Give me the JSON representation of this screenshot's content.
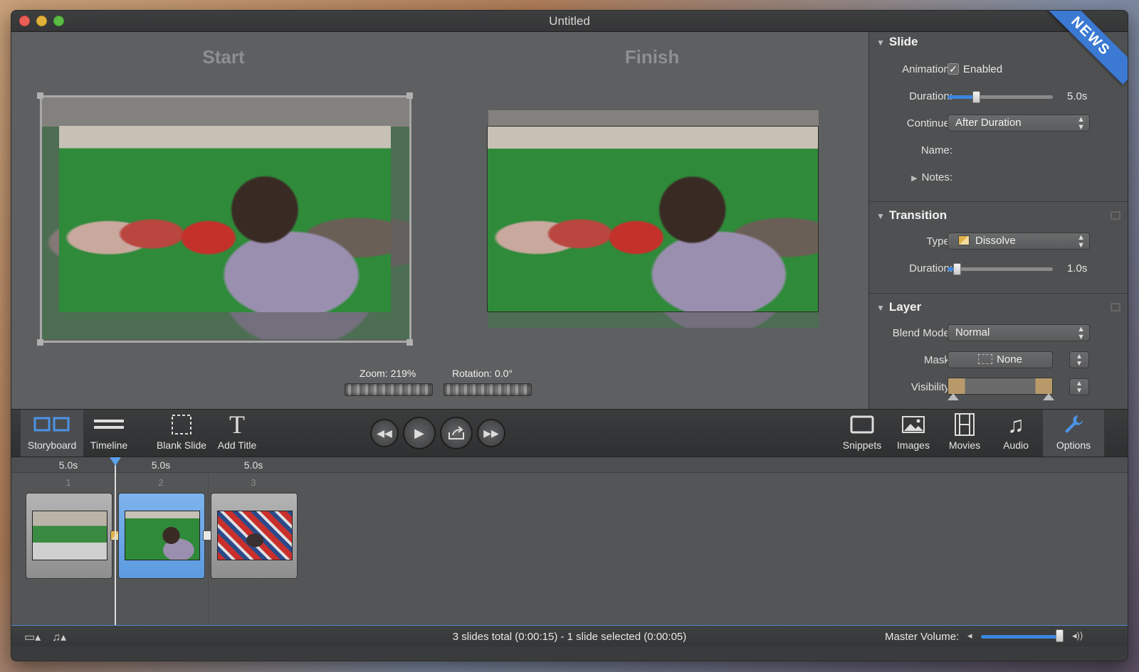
{
  "window": {
    "title": "Untitled",
    "ribbon": "NEWS"
  },
  "preview": {
    "start_label": "Start",
    "finish_label": "Finish",
    "zoom_label": "Zoom:",
    "zoom_value": "219%",
    "rotation_label": "Rotation:",
    "rotation_value": "0.0°"
  },
  "inspector": {
    "slide": {
      "header": "Slide",
      "animation_label": "Animation:",
      "animation_enabled": "Enabled",
      "duration_label": "Duration:",
      "duration_value": "5.0s",
      "duration_fraction": 0.27,
      "continue_label": "Continue:",
      "continue_value": "After Duration",
      "name_label": "Name:",
      "notes_label": "Notes:"
    },
    "transition": {
      "header": "Transition",
      "type_label": "Type:",
      "type_value": "Dissolve",
      "duration_label": "Duration:",
      "duration_value": "1.0s",
      "duration_fraction": 0.09
    },
    "layer": {
      "header": "Layer",
      "blend_label": "Blend Mode:",
      "blend_value": "Normal",
      "mask_label": "Mask:",
      "mask_value": "None",
      "visibility_label": "Visibility:"
    }
  },
  "toolbar": {
    "storyboard": "Storyboard",
    "timeline": "Timeline",
    "blank_slide": "Blank Slide",
    "add_title": "Add Title",
    "snippets": "Snippets",
    "images": "Images",
    "movies": "Movies",
    "audio": "Audio",
    "options": "Options"
  },
  "timeline": {
    "slides": [
      {
        "duration": "5.0s",
        "number": "1"
      },
      {
        "duration": "5.0s",
        "number": "2"
      },
      {
        "duration": "5.0s",
        "number": "3"
      }
    ]
  },
  "status": {
    "summary": "3 slides total (0:00:15)  -  1 slide selected (0:00:05)",
    "volume_label": "Master Volume:",
    "volume_fraction": 0.95
  },
  "colors": {
    "accent": "#3b86e0",
    "selected_slide": "#6aa6e8"
  }
}
